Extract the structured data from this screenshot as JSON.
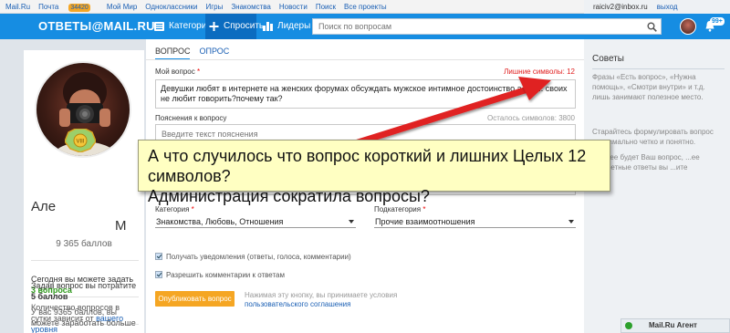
{
  "portal": {
    "links": [
      "Mail.Ru",
      "Почта",
      "Мой Мир",
      "Одноклассники",
      "Игры",
      "Знакомства",
      "Новости",
      "Поиск",
      "Все проекты"
    ],
    "mail_badge": "34420",
    "user_email": "raiciv2@inbox.ru",
    "logout": "выход"
  },
  "header": {
    "logo": "ОТВЕТЫ@MAIL.RU",
    "categories": "Категории",
    "ask": "Спросить",
    "leaders": "Лидеры",
    "search_placeholder": "Поиск по вопросам",
    "notification_count": "99+"
  },
  "profile": {
    "name": "Але",
    "name_tail": "М",
    "points": "9 365 баллов",
    "today_label": "Сегодня вы можете задать",
    "today_value": "3 вопроса",
    "count_info": "Количество вопросов в сутки зависит от",
    "level_link": "вашего уровня",
    "spend_label": "Задав вопрос вы потратите",
    "spend_value": "5 баллов",
    "balance_info": "У вас 9365 баллов, вы можете заработать больше"
  },
  "form": {
    "tab_question": "ВОПРОС",
    "tab_poll": "ОПРОС",
    "my_question_label": "Мой вопрос",
    "extra_chars": "Лишние символы: 12",
    "question_text": "Девушки любят в интернете на женских форумах обсуждать мужское интимное достоинство а о м... своих не любит говорить?почему так?",
    "explanation_label": "Пояснения к вопросу",
    "remaining": "Осталось символов: 3800",
    "explanation_placeholder": "Введите текст пояснения",
    "category_label": "Категория",
    "category_value": "Знакомства, Любовь, Отношения",
    "subcategory_label": "Подкатегория",
    "subcategory_value": "Прочие взаимоотношения",
    "notify_label": "Получать уведомления (ответы, голоса, комментарии)",
    "comments_label": "Разрешить комментарии к ответам",
    "publish": "Опубликовать вопрос",
    "agree_text": "Нажимая эту кнопку, вы принимаете условия",
    "agree_link": "пользовательского соглашения"
  },
  "tips": {
    "title": "Советы",
    "p1": "Фразы «Есть вопрос», «Нужна помощь», «Смотри внутри» и т.д. лишь занимают полезное место.",
    "p2": "Старайтесь формулировать вопрос максимально четко и понятно.",
    "p3": "...яснее будет Ваш вопрос, ...ее конкретные ответы вы ...ите"
  },
  "agent": {
    "label": "Mail.Ru Агент"
  },
  "annotation": {
    "line1": "А что случилось что вопрос короткий и лишних Целых 12 символов?",
    "line2": "Администрация сократила вопросы?"
  },
  "colors": {
    "brand": "#168de2",
    "publish": "#f5a623",
    "error": "#e02020",
    "note": "#ffffc2",
    "arrow": "#e02020"
  }
}
